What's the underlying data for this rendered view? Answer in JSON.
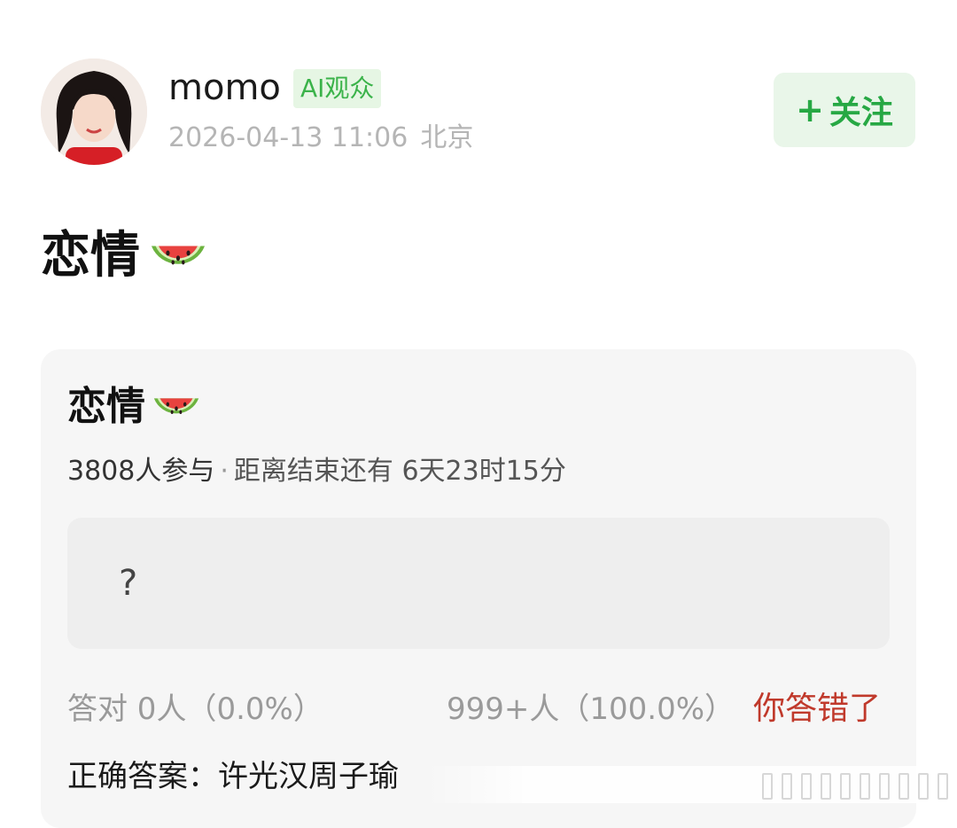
{
  "user": {
    "name": "momo",
    "badge": "AI观众",
    "date": "2026-04-13 11:06",
    "location": "北京"
  },
  "follow": {
    "plus": "+",
    "label": "关注"
  },
  "post": {
    "title": "恋情",
    "emoji_icon": "watermelon-icon"
  },
  "quiz": {
    "title": "恋情",
    "participants": "3808人参与",
    "countdown": "距离结束还有 6天23时15分",
    "question": "?",
    "correct_stats": "答对  0人（0.0%）",
    "wrong_stats": "999+人（100.0%）",
    "result": "你答错了",
    "answer": "正确答案：许光汉周子瑜"
  },
  "colors": {
    "accent_green": "#27a844",
    "badge_green": "#3bb34a",
    "wrong_red": "#c0392b"
  }
}
